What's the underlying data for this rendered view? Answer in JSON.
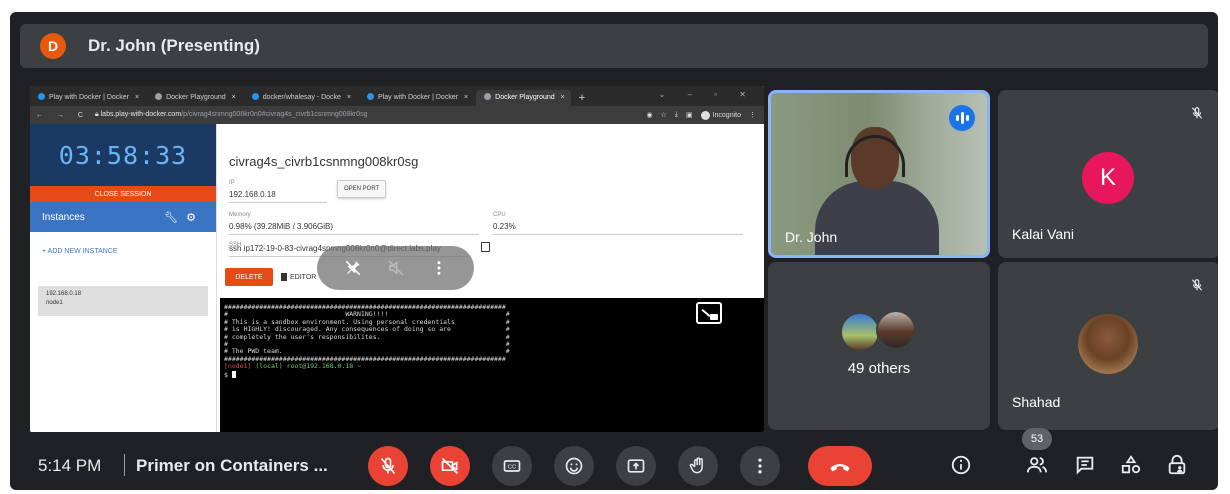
{
  "presenter": {
    "initial": "D",
    "title": "Dr. John (Presenting)"
  },
  "browser": {
    "tabs": [
      {
        "label": "Play with Docker | Docker",
        "close": "×"
      },
      {
        "label": "Docker Playground",
        "close": "×"
      },
      {
        "label": "docker/whalesay - Docke",
        "close": "×"
      },
      {
        "label": "Play with Docker | Docker",
        "close": "×"
      },
      {
        "label": "Docker Playground",
        "close": "×"
      }
    ],
    "new_tab": "+",
    "window_controls": "⌄ – ▫ ✕",
    "nav": "← → C",
    "url_host": "labs.play-with-docker.com",
    "url_path": "/p/civrag4snmng008kr0n0#civrag4s_civrb1csnmng008kr0sg",
    "incognito_label": "Incognito"
  },
  "pwd": {
    "timer": "03:58:33",
    "close_session": "CLOSE SESSION",
    "instances_label": "Instances",
    "add_instance": "+ ADD NEW INSTANCE",
    "node_ip": "192.168.0.18",
    "node_name": "node1",
    "host_title": "civrag4s_civrb1csnmng008kr0sg",
    "ip_label": "IP",
    "ip_value": "192.168.0.18",
    "open_port": "OPEN PORT",
    "memory_label": "Memory",
    "memory_value": "0.98% (39.28MiB / 3.906GiB)",
    "cpu_label": "CPU",
    "cpu_value": "0.23%",
    "ssh_label": "SSH",
    "ssh_value": "ssh ip172-19-0-83-civrag4snmng008kr0n0@direct.labs.play",
    "delete": "DELETE",
    "editor": "EDITOR"
  },
  "terminal": {
    "border": "########################################################################",
    "warning": "#                              WARNING!!!!                              #",
    "line1": "# This is a sandbox environment. Using personal credentials             #",
    "line2": "# is HIGHLY! discouraged. Any consequences of doing so are              #",
    "line3": "# completely the user's responsibilites.                                #",
    "line4": "#                                                                       #",
    "line5": "# The PWD team.                                                         #",
    "prompt_node": "[node1]",
    "prompt_local": "(local)",
    "prompt_rest": "root@192.168.0.18 ~",
    "prompt_dollar": "$ "
  },
  "participants": {
    "john": "Dr. John",
    "kalai": "Kalai Vani",
    "kalai_initial": "K",
    "others": "49 others",
    "shahad": "Shahad"
  },
  "bottom": {
    "time": "5:14 PM",
    "divider": "|",
    "meeting_title": "Primer on Containers ...",
    "participant_count": "53"
  },
  "colors": {
    "meet_bg": "#202124",
    "tile_bg": "#3c4043",
    "red": "#ea4335",
    "speaking_blue": "#1a73e8",
    "k_avatar": "#e8175d"
  }
}
